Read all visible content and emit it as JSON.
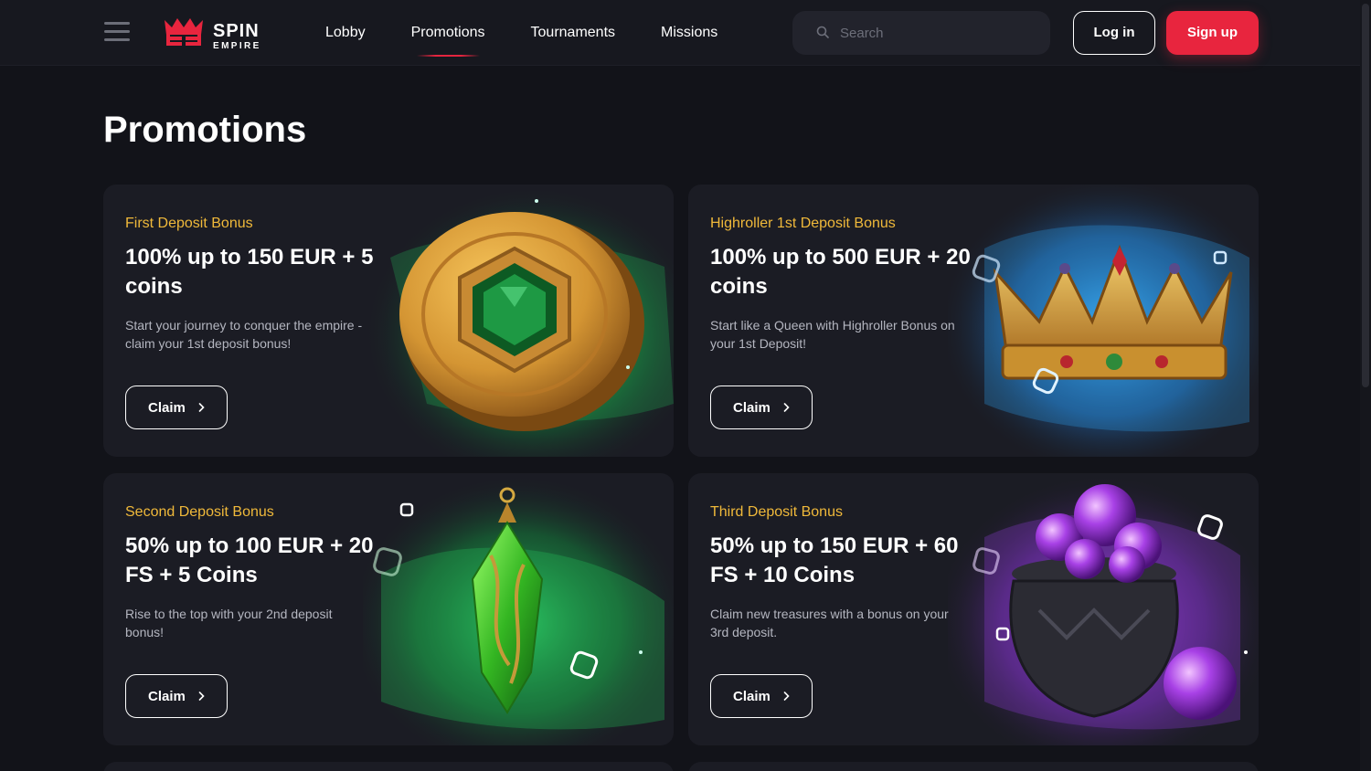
{
  "header": {
    "logo": {
      "line1": "SPIN",
      "line2": "EMPIRE"
    },
    "nav": [
      {
        "label": "Lobby",
        "active": false
      },
      {
        "label": "Promotions",
        "active": true
      },
      {
        "label": "Tournaments",
        "active": false
      },
      {
        "label": "Missions",
        "active": false
      }
    ],
    "search_placeholder": "Search",
    "login_label": "Log in",
    "signup_label": "Sign up"
  },
  "page_title": "Promotions",
  "promotions": [
    {
      "category": "First Deposit Bonus",
      "headline": "100% up to 150 EUR + 5 coins",
      "description": "Start your journey to conquer the empire - claim your 1st deposit bonus!",
      "button": "Claim",
      "art": "gold-coin-emerald"
    },
    {
      "category": "Highroller 1st Deposit Bonus",
      "headline": "100% up to 500 EUR + 20 coins",
      "description": "Start like a Queen with Highroller Bonus on your 1st Deposit!",
      "button": "Claim",
      "art": "golden-crown"
    },
    {
      "category": "Second Deposit Bonus",
      "headline": "50% up to 100 EUR + 20 FS + 5 Coins",
      "description": "Rise to the top with your 2nd deposit bonus!",
      "button": "Claim",
      "art": "green-crystal-pendant"
    },
    {
      "category": "Third Deposit Bonus",
      "headline": "50% up to 150 EUR + 60 FS + 10 Coins",
      "description": "Claim new treasures with a bonus on your 3rd deposit.",
      "button": "Claim",
      "art": "cauldron-purple-orbs"
    }
  ],
  "colors": {
    "background": "#121319",
    "header": "#17181f",
    "card": "#1b1c24",
    "accent_red": "#e8253e",
    "category_gold": "#f0b93a",
    "muted_text": "#b4b6c0"
  }
}
